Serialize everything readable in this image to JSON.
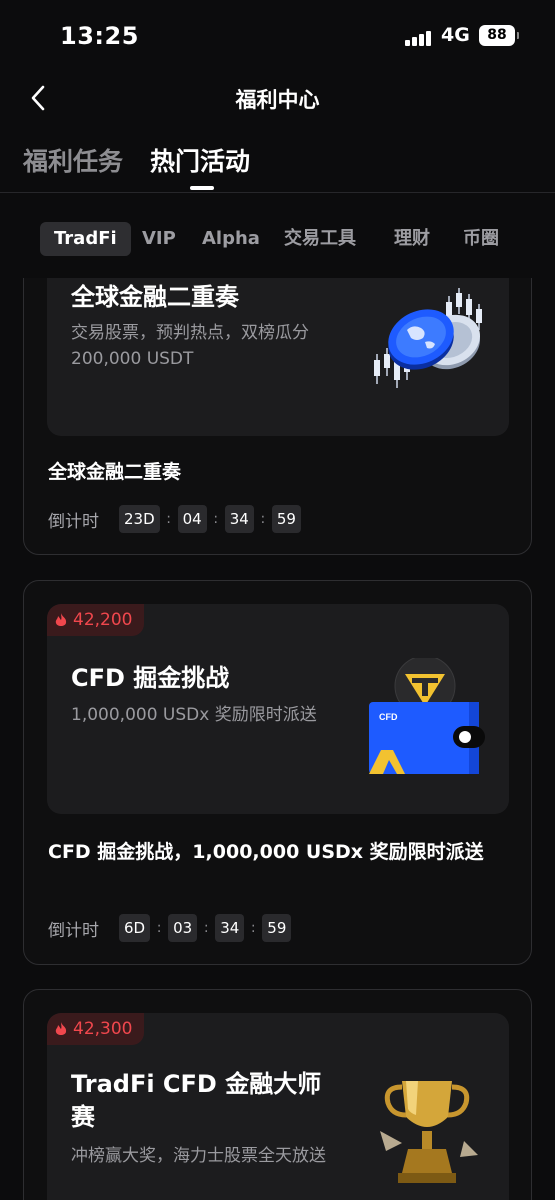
{
  "status_bar": {
    "time": "13:25",
    "network": "4G",
    "battery": "88"
  },
  "header": {
    "title": "福利中心"
  },
  "main_tabs": [
    {
      "label": "福利任务",
      "active": false
    },
    {
      "label": "热门活动",
      "active": true
    }
  ],
  "category_tabs": [
    {
      "label": "TradFi",
      "active": true
    },
    {
      "label": "VIP",
      "active": false
    },
    {
      "label": "Alpha",
      "active": false
    },
    {
      "label": "交易工具",
      "active": false
    },
    {
      "label": "理财",
      "active": false
    },
    {
      "label": "币圈",
      "active": false
    }
  ],
  "cards": [
    {
      "banner_title": "全球金融二重奏",
      "banner_subtitle": "交易股票，预判热点，双榜瓜分 200,000 USDT",
      "title": "全球金融二重奏",
      "countdown_label": "倒计时",
      "countdown": {
        "days": "23D",
        "hours": "04",
        "minutes": "34",
        "seconds": "59"
      },
      "art_icon": "globe-coins-candlestick-icon"
    },
    {
      "hot_count": "42,200",
      "banner_title": "CFD 掘金挑战",
      "banner_subtitle": "1,000,000 USDx 奖励限时派送",
      "title": "CFD 掘金挑战，1,000,000 USDx 奖励限时派送",
      "countdown_label": "倒计时",
      "countdown": {
        "days": "6D",
        "hours": "03",
        "minutes": "34",
        "seconds": "59"
      },
      "art_icon": "cfd-wallet-tether-icon",
      "art_text": "CFD"
    },
    {
      "hot_count": "42,300",
      "banner_title": "TradFi CFD 金融大师赛",
      "banner_subtitle": "冲榜赢大奖，海力士股票全天放送",
      "art_icon": "trophy-icon"
    }
  ],
  "colors": {
    "background": "#0c0c0d",
    "banner": "#1c1c1e",
    "hot": "#f0474d",
    "accent_blue": "#1e5bff",
    "accent_gold": "#f2c230"
  }
}
